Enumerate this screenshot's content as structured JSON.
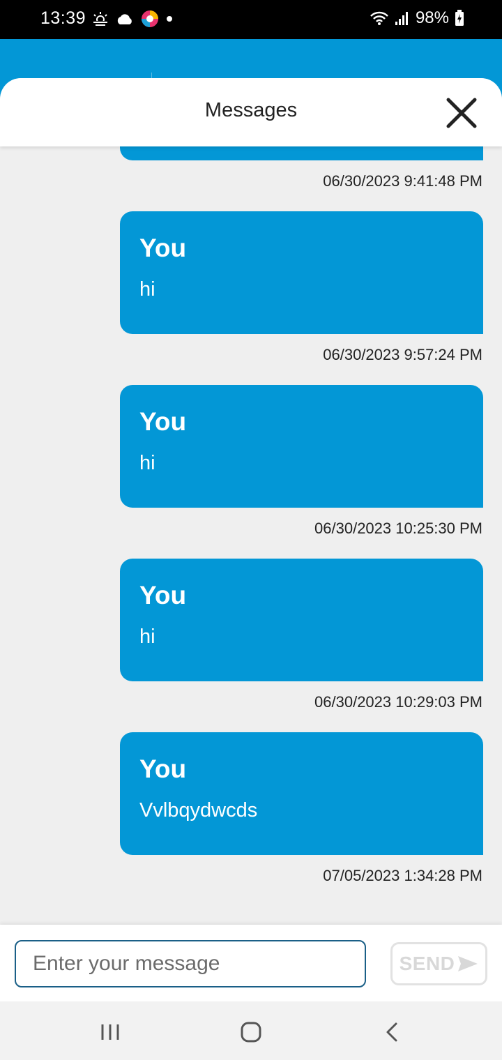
{
  "status_bar": {
    "time": "13:39",
    "battery": "98%"
  },
  "sheet": {
    "title": "Messages"
  },
  "messages": [
    {
      "timestamp": "06/30/2023 9:41:48 PM"
    },
    {
      "sender": "You",
      "text": "hi",
      "timestamp": "06/30/2023 9:57:24 PM"
    },
    {
      "sender": "You",
      "text": "hi",
      "timestamp": "06/30/2023 10:25:30 PM"
    },
    {
      "sender": "You",
      "text": "hi",
      "timestamp": "06/30/2023 10:29:03 PM"
    },
    {
      "sender": "You",
      "text": "Vvlbqydwcds",
      "timestamp": "07/05/2023 1:34:28 PM"
    }
  ],
  "composer": {
    "placeholder": "Enter your message",
    "send_label": "SEND"
  },
  "colors": {
    "accent": "#0397d6",
    "background": "#efefef"
  }
}
